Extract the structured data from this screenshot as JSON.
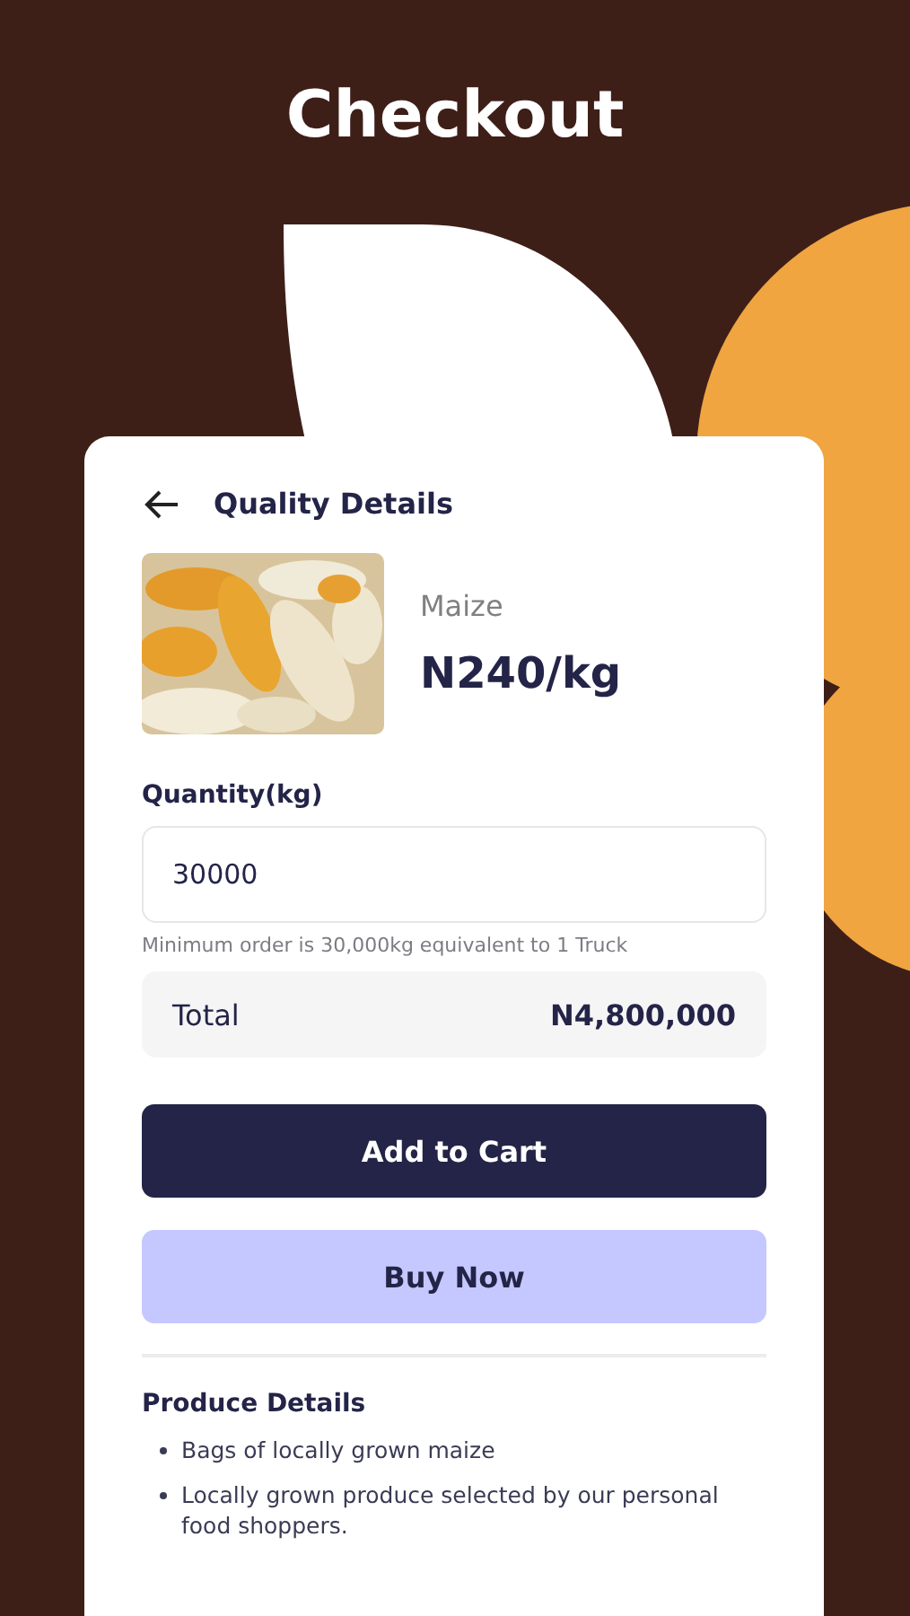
{
  "title": "Checkout",
  "header": {
    "title": "Quality Details"
  },
  "product": {
    "name": "Maize",
    "price": "N240/kg"
  },
  "quantity": {
    "label": "Quantity(kg)",
    "value": "30000",
    "hint": "Minimum order is 30,000kg equivalent to 1 Truck"
  },
  "total": {
    "label": "Total",
    "value": "N4,800,000"
  },
  "buttons": [
    {
      "label": "Add to Cart",
      "kind": "primary"
    },
    {
      "label": "Buy Now",
      "kind": "secondary"
    }
  ],
  "details": {
    "title": "Produce Details",
    "items": [
      "Bags of locally grown maize",
      "Locally grown produce selected by our personal food shoppers."
    ]
  }
}
